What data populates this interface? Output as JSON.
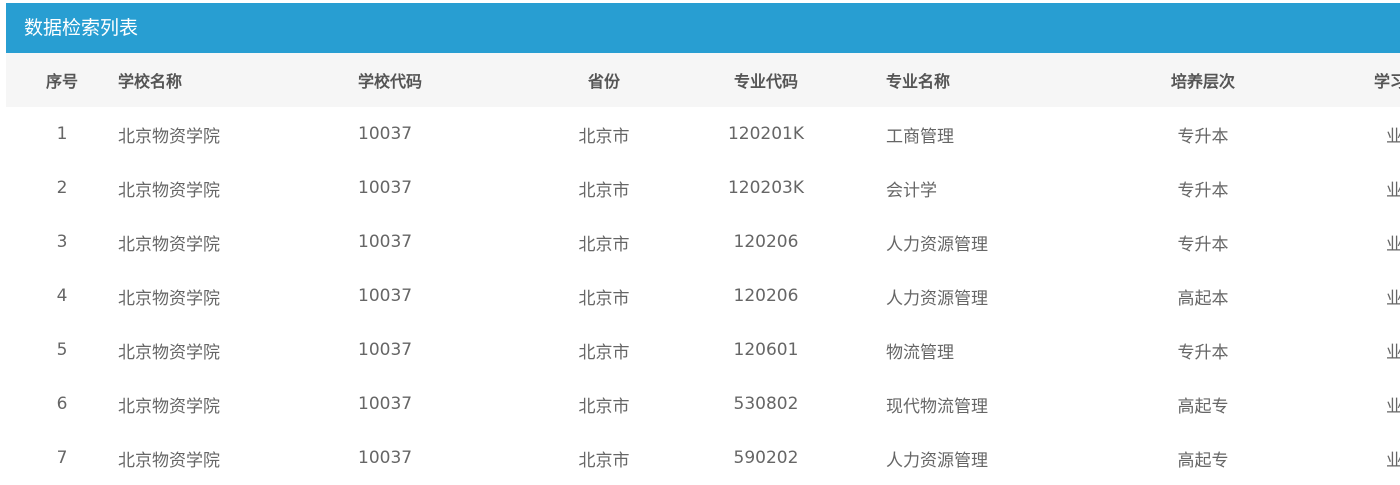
{
  "panel": {
    "title": "数据检索列表"
  },
  "table": {
    "headers": {
      "index": "序号",
      "school_name": "学校名称",
      "school_code": "学校代码",
      "province": "省份",
      "major_code": "专业代码",
      "major_name": "专业名称",
      "level": "培养层次",
      "study_form": "学习形式"
    },
    "rows": [
      {
        "index": "1",
        "school_name": "北京物资学院",
        "school_code": "10037",
        "province": "北京市",
        "major_code": "120201K",
        "major_name": "工商管理",
        "level": "专升本",
        "study_form": "业余"
      },
      {
        "index": "2",
        "school_name": "北京物资学院",
        "school_code": "10037",
        "province": "北京市",
        "major_code": "120203K",
        "major_name": "会计学",
        "level": "专升本",
        "study_form": "业余"
      },
      {
        "index": "3",
        "school_name": "北京物资学院",
        "school_code": "10037",
        "province": "北京市",
        "major_code": "120206",
        "major_name": "人力资源管理",
        "level": "专升本",
        "study_form": "业余"
      },
      {
        "index": "4",
        "school_name": "北京物资学院",
        "school_code": "10037",
        "province": "北京市",
        "major_code": "120206",
        "major_name": "人力资源管理",
        "level": "高起本",
        "study_form": "业余"
      },
      {
        "index": "5",
        "school_name": "北京物资学院",
        "school_code": "10037",
        "province": "北京市",
        "major_code": "120601",
        "major_name": "物流管理",
        "level": "专升本",
        "study_form": "业余"
      },
      {
        "index": "6",
        "school_name": "北京物资学院",
        "school_code": "10037",
        "province": "北京市",
        "major_code": "530802",
        "major_name": "现代物流管理",
        "level": "高起专",
        "study_form": "业余"
      },
      {
        "index": "7",
        "school_name": "北京物资学院",
        "school_code": "10037",
        "province": "北京市",
        "major_code": "590202",
        "major_name": "人力资源管理",
        "level": "高起专",
        "study_form": "业余"
      }
    ]
  },
  "colors": {
    "header_bar": "#289ed2",
    "table_head_bg": "#f6f6f6"
  }
}
